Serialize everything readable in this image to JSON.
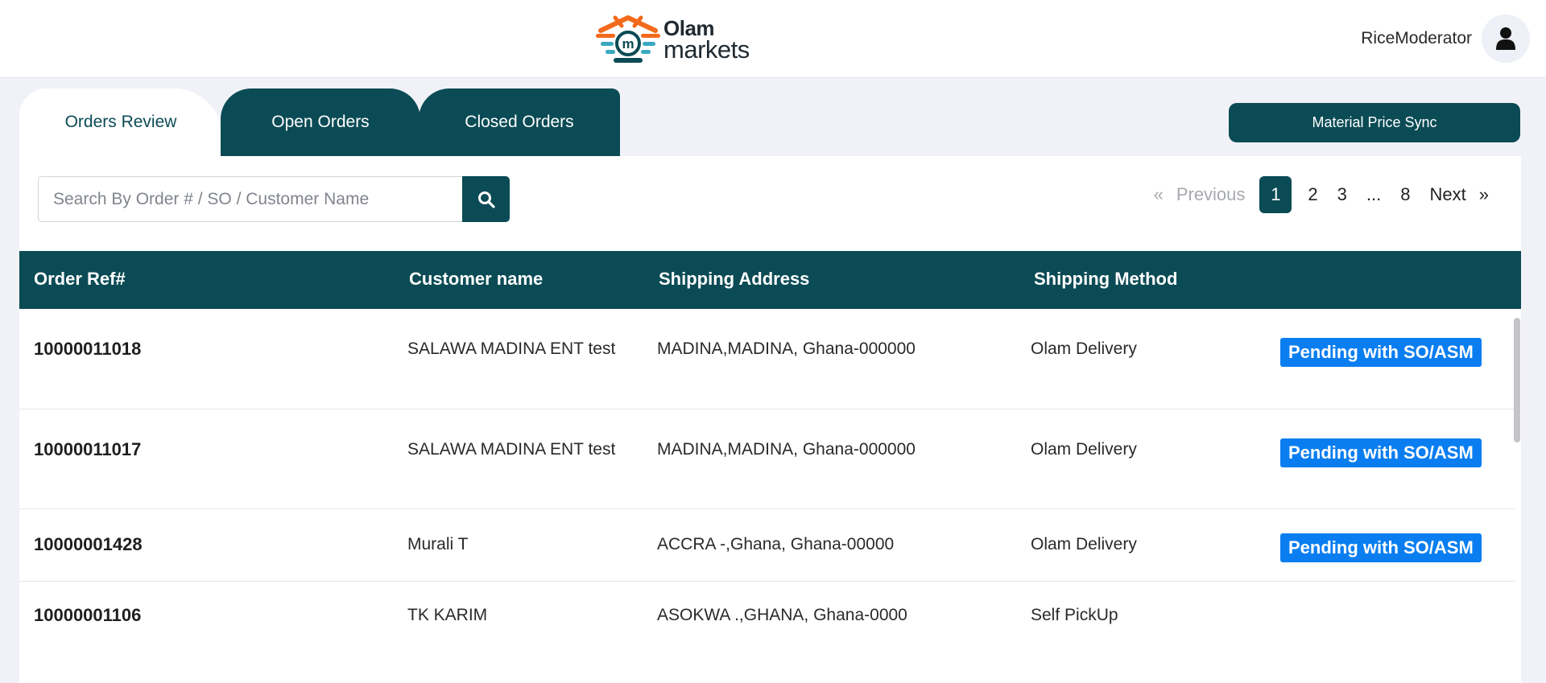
{
  "header": {
    "brand_line1": "Olam",
    "brand_line2": "markets",
    "user_name": "RiceModerator",
    "avatar_icon": "user-icon"
  },
  "tabs": [
    {
      "label": "Orders Review",
      "active": true
    },
    {
      "label": "Open Orders",
      "active": false
    },
    {
      "label": "Closed Orders",
      "active": false
    }
  ],
  "actions": {
    "material_price_sync": "Material Price Sync"
  },
  "search": {
    "placeholder": "Search By Order # / SO / Customer Name",
    "value": "",
    "icon": "search-icon"
  },
  "pagination": {
    "first": "«",
    "previous": "Previous",
    "pages": [
      "1",
      "2",
      "3",
      "...",
      "8"
    ],
    "current": "1",
    "next": "Next",
    "last": "»"
  },
  "table": {
    "columns": [
      "Order Ref#",
      "Customer name",
      "Shipping Address",
      "Shipping Method",
      ""
    ],
    "rows": [
      {
        "ref": "10000011018",
        "customer": "SALAWA MADINA ENT test",
        "address": "MADINA,MADINA, Ghana-000000",
        "method": "Olam Delivery",
        "status": "Pending with SO/ASM"
      },
      {
        "ref": "10000011017",
        "customer": "SALAWA MADINA ENT test",
        "address": "MADINA,MADINA, Ghana-000000",
        "method": "Olam Delivery",
        "status": "Pending with SO/ASM"
      },
      {
        "ref": "10000001428",
        "customer": "Murali T",
        "address": "ACCRA -,Ghana, Ghana-00000",
        "method": "Olam Delivery",
        "status": "Pending with SO/ASM"
      },
      {
        "ref": "10000001106",
        "customer": "TK KARIM",
        "address": "ASOKWA .,GHANA, Ghana-0000",
        "method": "Self PickUp",
        "status": ""
      }
    ]
  },
  "colors": {
    "primary": "#0b4b55",
    "badge": "#0a7ef0",
    "background": "#f1f2f8"
  }
}
